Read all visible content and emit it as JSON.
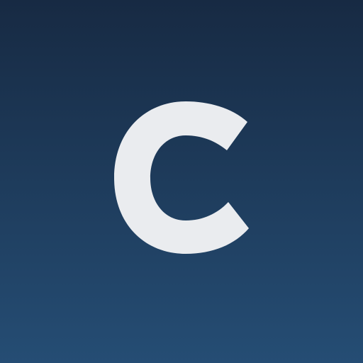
{
  "logo": {
    "letter": "C",
    "letter_color": "#eaecef",
    "background_gradient": [
      "#172a43",
      "#254d74"
    ]
  }
}
